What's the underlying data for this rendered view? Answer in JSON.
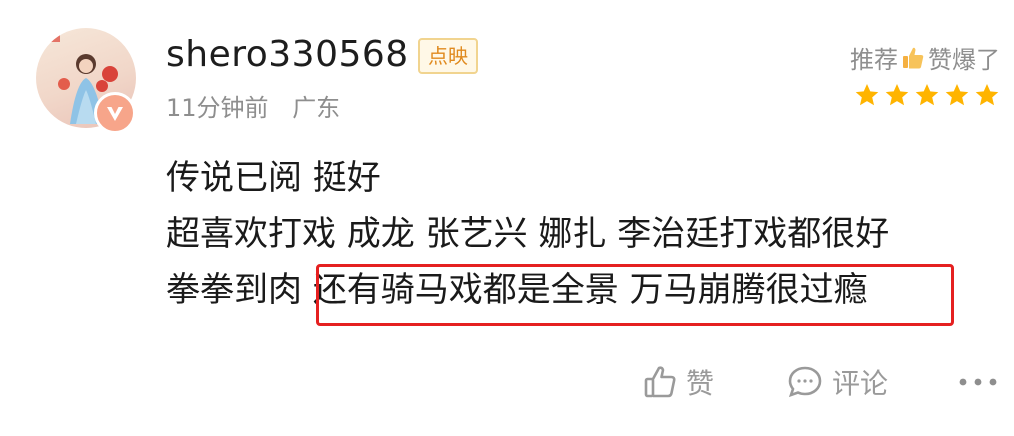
{
  "review": {
    "username": "shero330568",
    "tag": "点映",
    "time": "11分钟前",
    "location": "广东",
    "recommend_prefix": "推荐",
    "recommend_suffix": "赞爆了",
    "stars": 5,
    "lines": [
      "传说已阅 挺好",
      "超喜欢打戏 成龙 张艺兴 娜扎 李治廷打戏都很好",
      "拳拳到肉 ",
      "还有骑马戏都是全景 万马崩腾很过瘾"
    ],
    "colors": {
      "star": "#ffb400",
      "highlight_border": "#e52020",
      "tag_text": "#e08a1e"
    }
  },
  "actions": {
    "like_label": "赞",
    "comment_label": "评论",
    "like_icon": "thumb-up-icon",
    "comment_icon": "comment-bubble-icon",
    "more_icon": "more-dots-icon"
  }
}
